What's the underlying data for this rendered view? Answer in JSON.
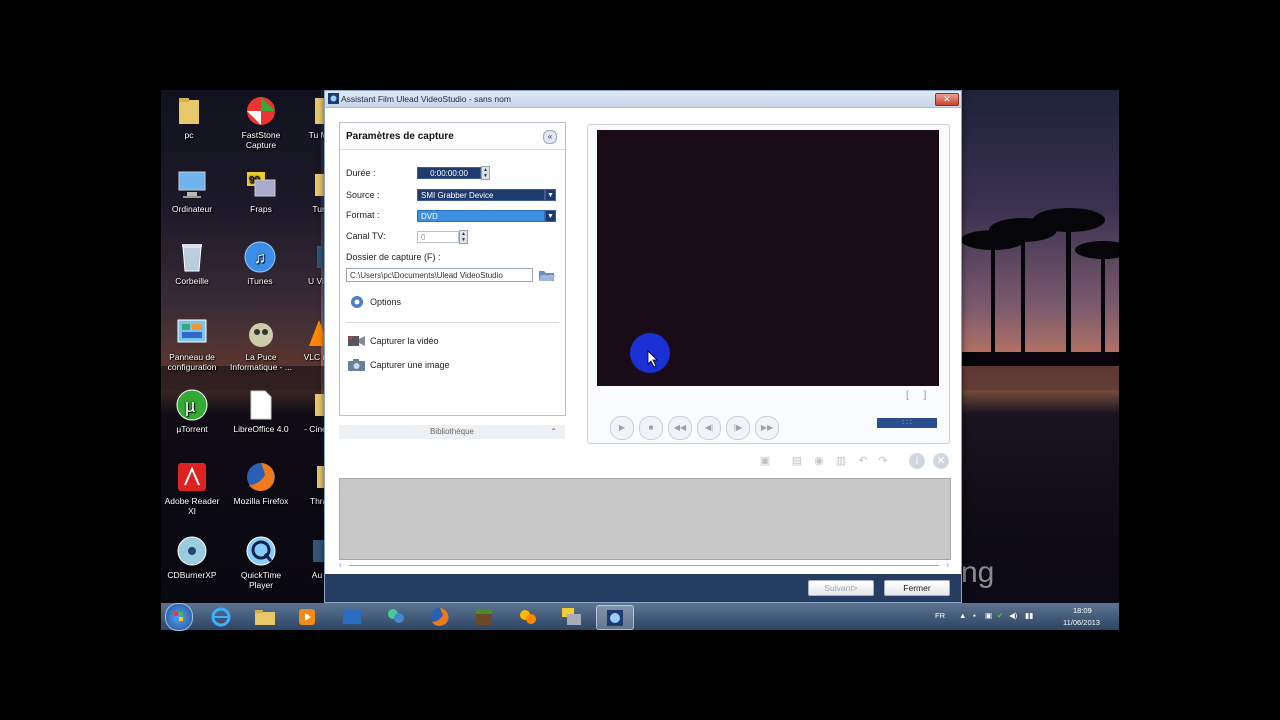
{
  "desktop": {
    "icons": [
      {
        "label": "pc",
        "icon": "folder-icon"
      },
      {
        "label": "FastStone Capture",
        "icon": "faststone-icon"
      },
      {
        "label": "Tu Maint",
        "icon": "tuneup-icon"
      },
      {
        "label": "Ordinateur",
        "icon": "computer-icon"
      },
      {
        "label": "Fraps",
        "icon": "fraps-icon"
      },
      {
        "label": "TuneU",
        "icon": "tuneup-icon"
      },
      {
        "label": "Corbeille",
        "icon": "recycle-bin-icon"
      },
      {
        "label": "iTunes",
        "icon": "itunes-icon"
      },
      {
        "label": "U Video",
        "icon": "video-icon"
      },
      {
        "label": "Panneau de configuration",
        "icon": "control-panel-icon"
      },
      {
        "label": "La Puce Informatique - ...",
        "icon": "lapuce-icon"
      },
      {
        "label": "VLC me",
        "icon": "vlc-icon"
      },
      {
        "label": "µTorrent",
        "icon": "utorrent-icon"
      },
      {
        "label": "LibreOffice 4.0",
        "icon": "libreoffice-icon"
      },
      {
        "label": "- Cinem",
        "icon": "folder-icon"
      },
      {
        "label": "Adobe Reader XI",
        "icon": "adobe-reader-icon"
      },
      {
        "label": "Mozilla Firefox",
        "icon": "firefox-icon"
      },
      {
        "label": "Thrau",
        "icon": "folder-icon"
      },
      {
        "label": "CDBurnerXP",
        "icon": "cdburner-icon"
      },
      {
        "label": "QuickTime Player",
        "icon": "quicktime-icon"
      },
      {
        "label": "Au",
        "icon": "app-icon"
      }
    ],
    "watermark": "ng"
  },
  "window": {
    "title": "Assistant Film Ulead VideoStudio - sans nom",
    "panel_title": "Paramètres de capture",
    "duree_label": "Durée :",
    "duree_value": "0:00:00:00",
    "source_label": "Source :",
    "source_value": "SMI Grabber Device",
    "format_label": "Format :",
    "format_value": "DVD",
    "canal_label": "Canal TV:",
    "canal_value": "0",
    "dossier_label": "Dossier de capture (F) :",
    "dossier_value": "C:\\Users\\pc\\Documents\\Ulead VideoStudio",
    "options_label": "Options",
    "capture_video_label": "Capturer la vidéo",
    "capture_image_label": "Capturer une image",
    "bibliotheque_label": "Bibliothèque",
    "timecode": ":  :  :",
    "suivant_label": "Suivant>",
    "fermer_label": "Fermer"
  },
  "taskbar": {
    "language": "FR",
    "time": "18:09",
    "date": "11/06/2013"
  },
  "colors": {
    "accent_dark": "#1f3a6e",
    "accent_blue": "#3d8fe0",
    "bottom_bar": "#253d63"
  }
}
